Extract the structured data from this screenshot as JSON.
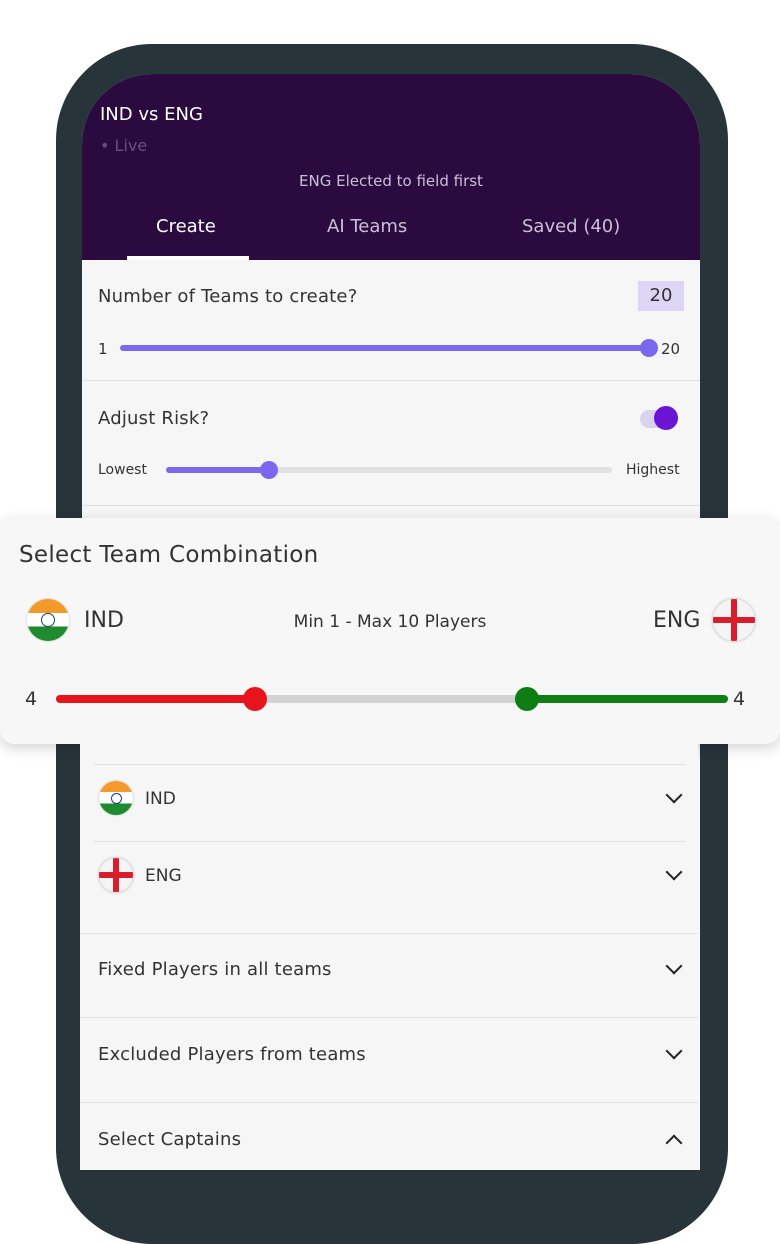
{
  "header": {
    "match_title": "IND vs ENG",
    "match_status": "• Live",
    "toss_text": "ENG Elected to field first",
    "tabs": [
      "Create",
      "AI Teams",
      "Saved (40)"
    ],
    "active_tab": "Create"
  },
  "teams_count": {
    "label": "Number of Teams to create?",
    "value": "20",
    "min_label": "1",
    "max_label": "20",
    "slider_fraction": 1.0
  },
  "risk": {
    "label": "Adjust Risk?",
    "toggle_on": true,
    "low_label": "Lowest",
    "high_label": "Highest",
    "slider_fraction": 0.24
  },
  "combination": {
    "title": "Select Team Combination",
    "team_left": "IND",
    "team_right": "ENG",
    "rule": "Min 1 - Max 10 Players",
    "left_value": "4",
    "right_value": "4",
    "colors": {
      "left": "#e8141c",
      "right": "#0e7d12",
      "track": "#d3d3d3"
    }
  },
  "team_rows": [
    {
      "team": "IND"
    },
    {
      "team": "ENG"
    }
  ],
  "sections": {
    "fixed_players": "Fixed Players in all teams",
    "excluded_players": "Excluded Players from teams",
    "select_captains": "Select Captains"
  },
  "colors": {
    "header_bg": "#2b0a40",
    "accent": "#7b68ee",
    "toggle": "#6a14d6",
    "phone_frame": "#27343a"
  }
}
